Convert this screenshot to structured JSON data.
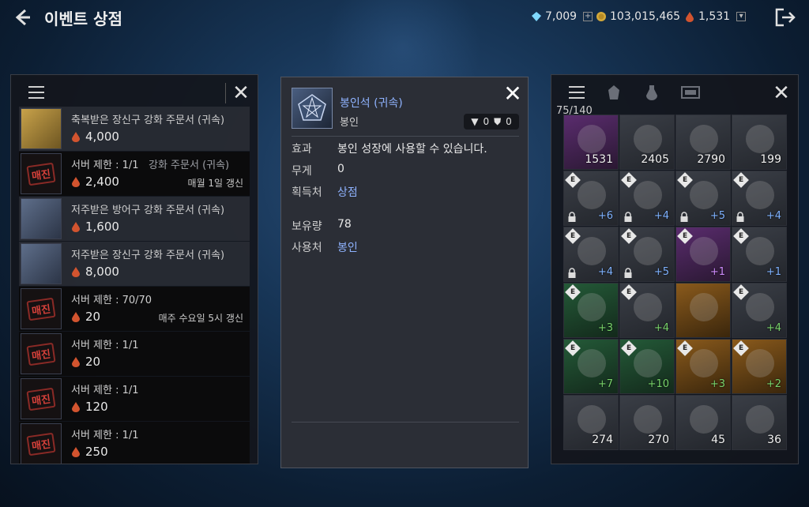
{
  "header": {
    "title": "이벤트 상점"
  },
  "currencies": [
    {
      "icon": "diamond-icon",
      "value": "7,009",
      "has_plus": true
    },
    {
      "icon": "gold-coin-icon",
      "value": "103,015,465",
      "has_plus": false
    },
    {
      "icon": "blood-drop-icon",
      "value": "1,531",
      "has_dropdown": true
    }
  ],
  "shop_rows": [
    {
      "name": "축복받은 장신구 강화 주문서 (귀속)",
      "price": "4,000",
      "thumb": "gold",
      "sold": false,
      "light": true,
      "reset": ""
    },
    {
      "name": "서버 제한 : 1/1",
      "name_suffix": "강화 주문서 (귀속)",
      "price": "2,400",
      "thumb": "sold",
      "sold": true,
      "light": false,
      "reset": "매월 1일 갱신"
    },
    {
      "name": "저주받은 방어구 강화 주문서 (귀속)",
      "price": "1,600",
      "thumb": "scroll",
      "sold": false,
      "light": true,
      "reset": ""
    },
    {
      "name": "저주받은 장신구 강화 주문서 (귀속)",
      "price": "8,000",
      "thumb": "scroll",
      "sold": false,
      "light": true,
      "reset": ""
    },
    {
      "name": "서버 제한 : 70/70",
      "price": "20",
      "thumb": "sold",
      "sold": true,
      "light": false,
      "reset": "매주 수요일 5시 갱신"
    },
    {
      "name": "서버 제한 : 1/1",
      "price": "20",
      "thumb": "sold",
      "sold": true,
      "light": false,
      "reset": ""
    },
    {
      "name": "서버 제한 : 1/1",
      "price": "120",
      "thumb": "sold",
      "sold": true,
      "light": false,
      "reset": ""
    },
    {
      "name": "서버 제한 : 1/1",
      "price": "250",
      "thumb": "sold",
      "sold": true,
      "light": false,
      "reset": ""
    }
  ],
  "sold_label": "매진",
  "popup": {
    "name": "봉인석 (귀속)",
    "category": "봉인",
    "badge_a": "0",
    "badge_b": "0",
    "attrs": [
      {
        "key": "효과",
        "value": "봉인 성장에 사용할 수 있습니다.",
        "link": false
      },
      {
        "key": "무게",
        "value": "0",
        "link": false
      },
      {
        "key": "획득처",
        "value": "상점",
        "link": true
      },
      {
        "key": "보유량",
        "value": "78",
        "link": false
      },
      {
        "key": "사용처",
        "value": "봉인",
        "link": true
      }
    ]
  },
  "inventory": {
    "capacity": "75/140",
    "slots": [
      {
        "color": "purple",
        "count": "1531"
      },
      {
        "color": "gray",
        "count": "2405"
      },
      {
        "color": "gray",
        "count": "2790"
      },
      {
        "color": "gray",
        "count": "199"
      },
      {
        "color": "gray",
        "e": true,
        "lock": true,
        "plus": "+6",
        "plus_color": "blue"
      },
      {
        "color": "gray",
        "e": true,
        "lock": true,
        "plus": "+4",
        "plus_color": "blue"
      },
      {
        "color": "gray",
        "e": true,
        "lock": true,
        "plus": "+5",
        "plus_color": "blue"
      },
      {
        "color": "gray",
        "e": true,
        "lock": true,
        "plus": "+4",
        "plus_color": "blue"
      },
      {
        "color": "gray",
        "e": true,
        "lock": true,
        "plus": "+4",
        "plus_color": "blue"
      },
      {
        "color": "gray",
        "e": true,
        "lock": true,
        "plus": "+5",
        "plus_color": "blue"
      },
      {
        "color": "purple",
        "e": true,
        "plus": "+1",
        "plus_color": "purple"
      },
      {
        "color": "gray",
        "e": true,
        "plus": "+1",
        "plus_color": "blue"
      },
      {
        "color": "green",
        "e": true,
        "plus": "+3",
        "plus_color": "green"
      },
      {
        "color": "gray",
        "e": true,
        "plus": "+4",
        "plus_color": "green"
      },
      {
        "color": "orange",
        "e": false,
        "plus": ""
      },
      {
        "color": "gray",
        "e": true,
        "plus": "+4",
        "plus_color": "green"
      },
      {
        "color": "green",
        "e": true,
        "plus": "+7",
        "plus_color": "green"
      },
      {
        "color": "green",
        "e": true,
        "plus": "+10",
        "plus_color": "green"
      },
      {
        "color": "orange",
        "e": true,
        "plus": "+3",
        "plus_color": "green"
      },
      {
        "color": "orange",
        "e": true,
        "plus": "+2",
        "plus_color": "green"
      },
      {
        "color": "gray",
        "count": "274"
      },
      {
        "color": "gray",
        "count": "270"
      },
      {
        "color": "gray",
        "count": "45"
      },
      {
        "color": "gray",
        "count": "36"
      }
    ]
  }
}
